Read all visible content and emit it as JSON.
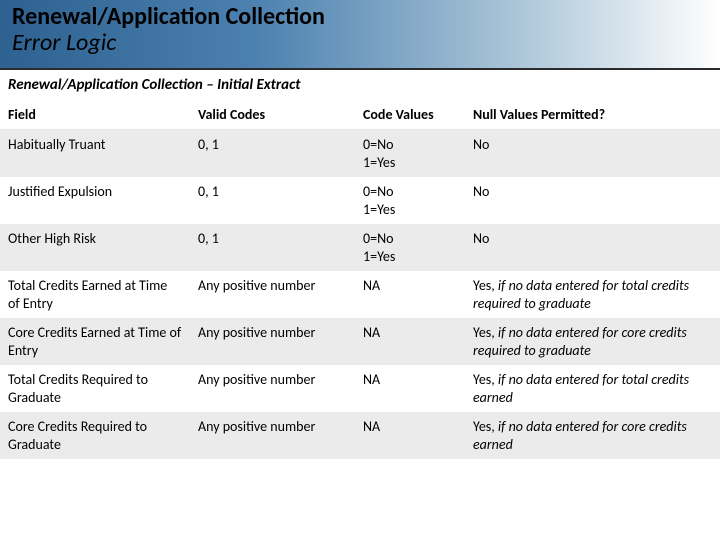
{
  "header": {
    "title": "Renewal/Application Collection",
    "subtitle": "Error Logic"
  },
  "section_heading": "Renewal/Application Collection – Initial Extract",
  "table": {
    "headers": {
      "field": "Field",
      "valid_codes": "Valid Codes",
      "code_values": "Code Values",
      "null_permitted": "Null Values Permitted?"
    },
    "rows": [
      {
        "field": "Habitually Truant",
        "valid_codes": "0, 1",
        "code_values": "0=No\n1=Yes",
        "null_prefix": "No",
        "null_italic": ""
      },
      {
        "field": "Justified Expulsion",
        "valid_codes": "0, 1",
        "code_values": "0=No\n1=Yes",
        "null_prefix": "No",
        "null_italic": ""
      },
      {
        "field": "Other High Risk",
        "valid_codes": "0, 1",
        "code_values": "0=No\n1=Yes",
        "null_prefix": "No",
        "null_italic": ""
      },
      {
        "field": "Total Credits Earned at Time of Entry",
        "valid_codes": "Any positive number",
        "code_values": "NA",
        "null_prefix": "Yes, ",
        "null_italic": "if no data entered for total credits required to graduate"
      },
      {
        "field": "Core Credits Earned at Time of Entry",
        "valid_codes": "Any positive number",
        "code_values": "NA",
        "null_prefix": "Yes, ",
        "null_italic": "if no data entered for core credits required to graduate"
      },
      {
        "field": "Total Credits Required to Graduate",
        "valid_codes": "Any positive number",
        "code_values": "NA",
        "null_prefix": "Yes, ",
        "null_italic": "if no data entered for total credits earned"
      },
      {
        "field": "Core Credits Required to Graduate",
        "valid_codes": "Any positive number",
        "code_values": "NA",
        "null_prefix": "Yes, ",
        "null_italic": "if no data entered for core credits earned"
      }
    ]
  }
}
